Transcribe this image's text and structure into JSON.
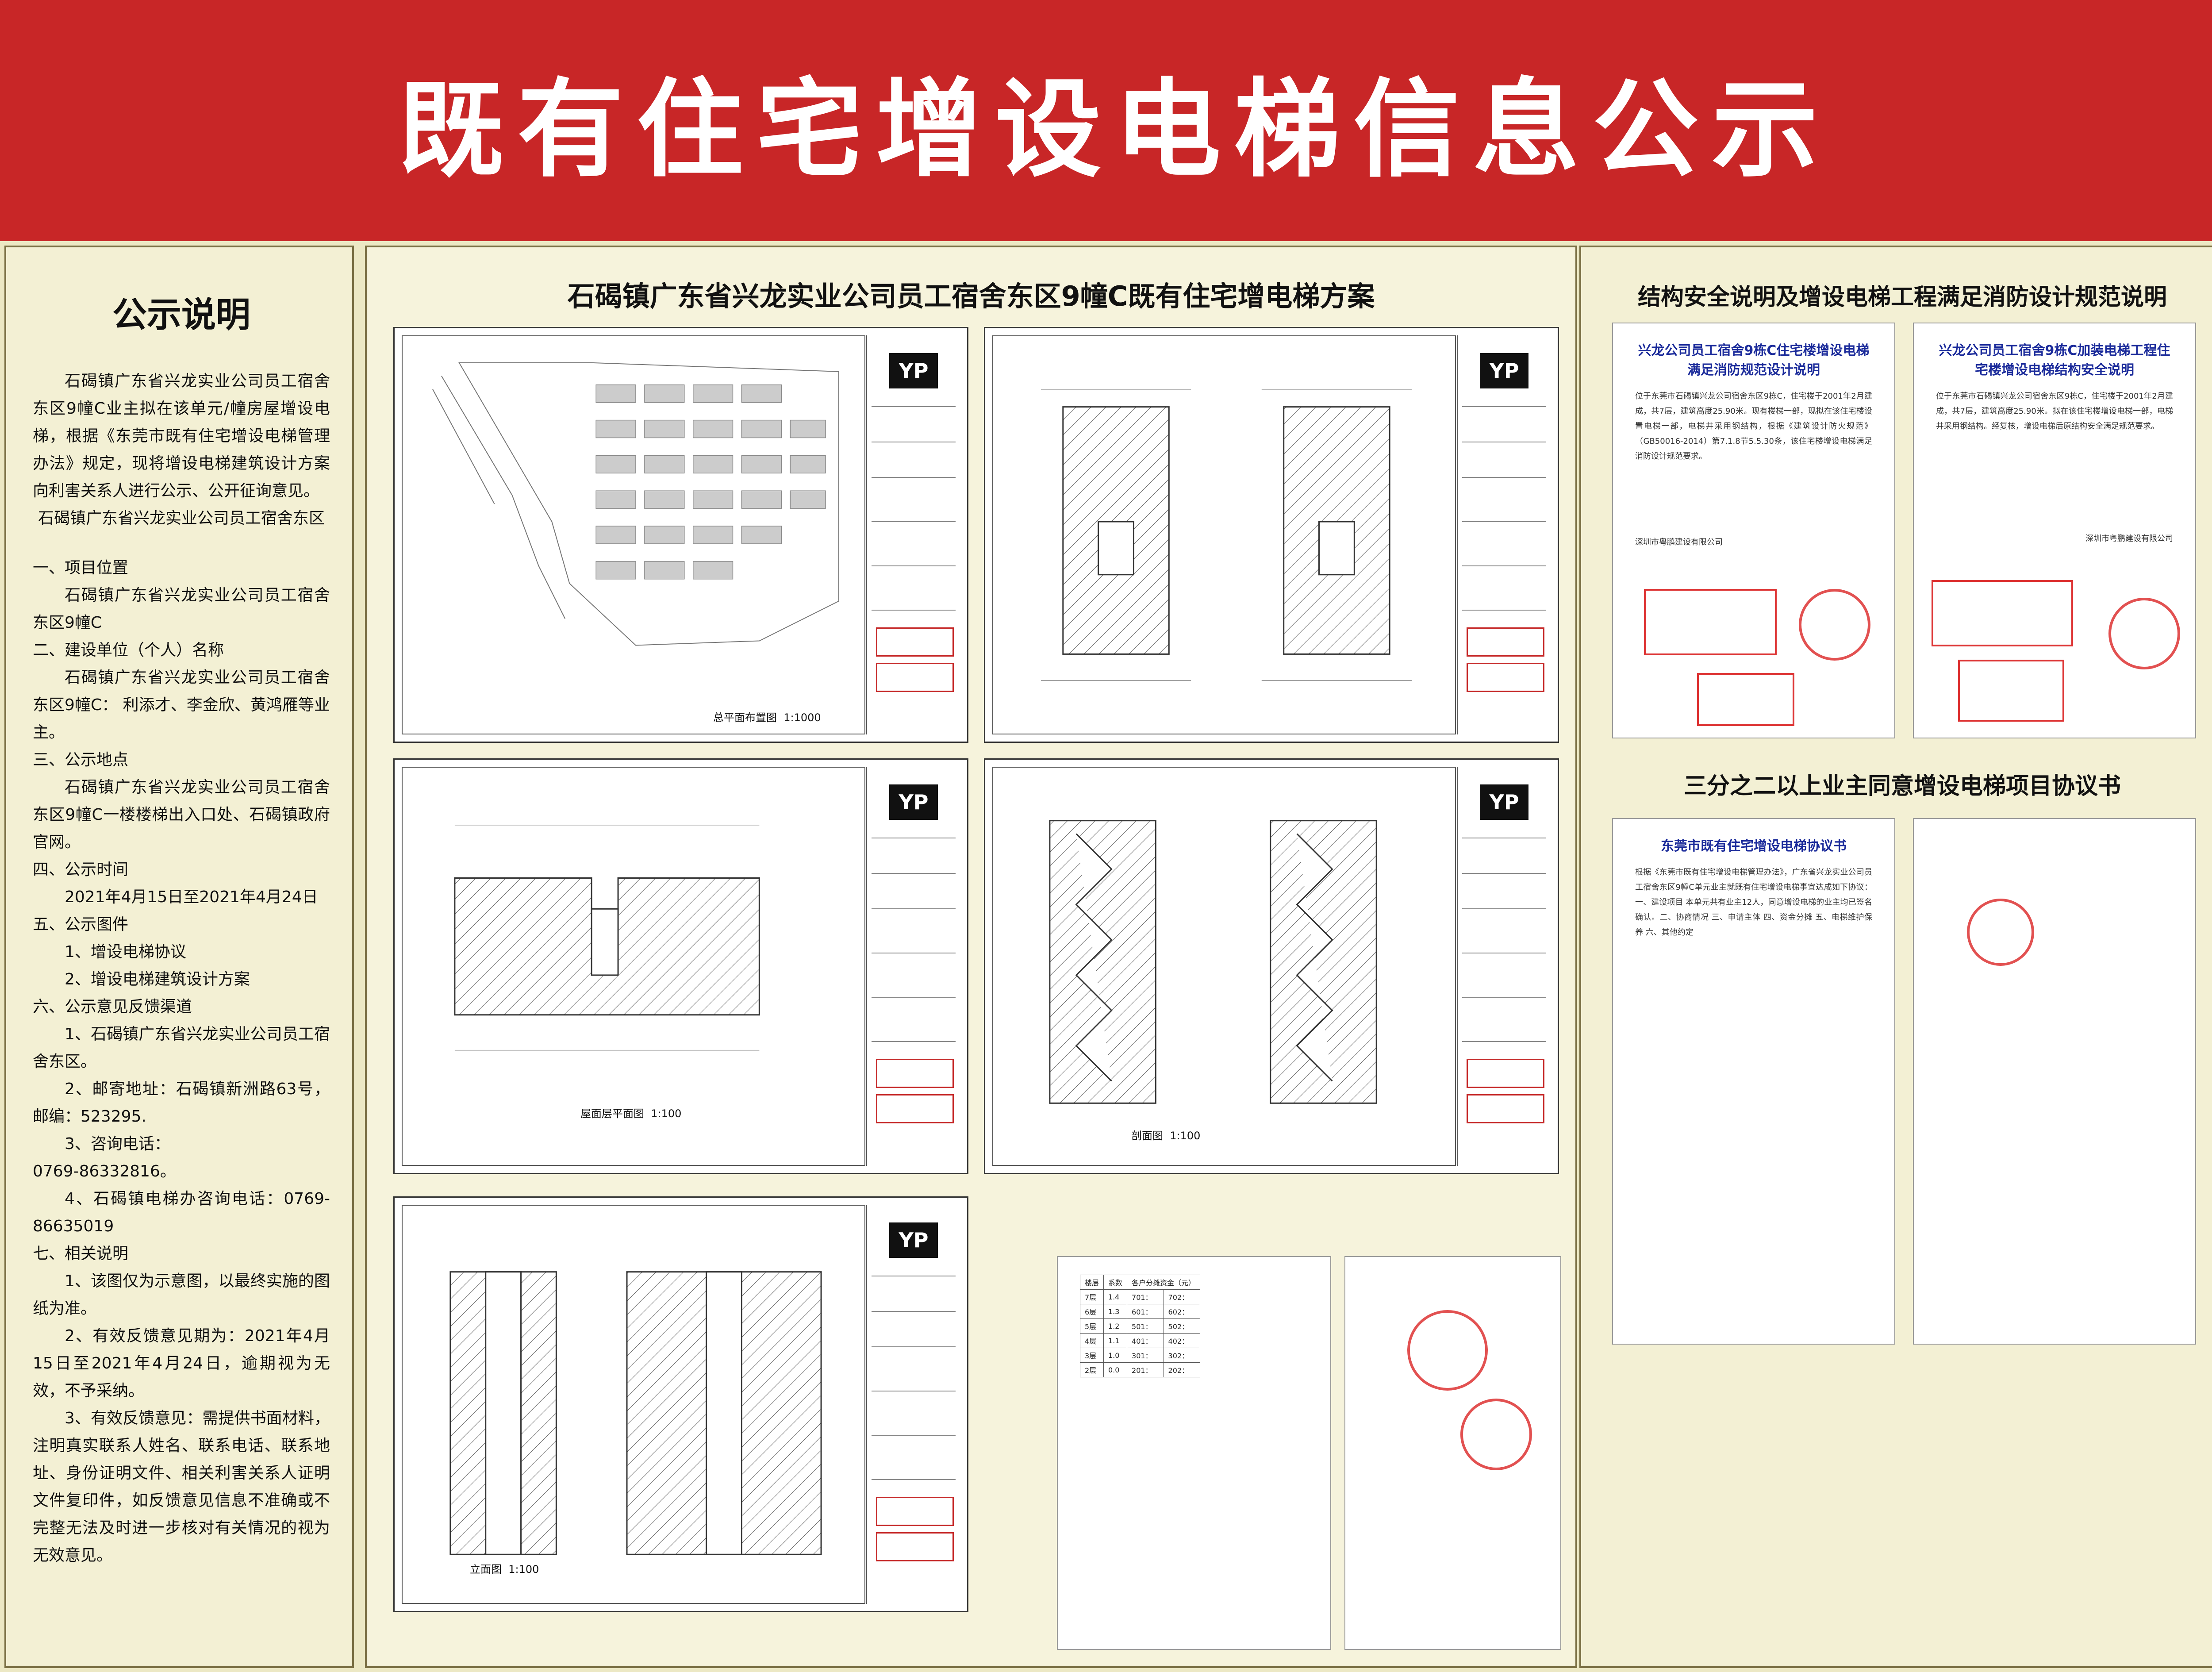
{
  "banner": {
    "title": "既有住宅增设电梯信息公示"
  },
  "notice": {
    "heading": "公示说明",
    "intro": "石碣镇广东省兴龙实业公司员工宿舍东区9幢C业主拟在该单元/幢房屋增设电梯，根据《东莞市既有住宅增设电梯管理办法》规定，现将增设电梯建筑设计方案向利害关系人进行公示、公开征询意见。",
    "signer": "石碣镇广东省兴龙实业公司员工宿舍东区",
    "s1_title": "一、项目位置",
    "s1_text": "石碣镇广东省兴龙实业公司员工宿舍东区9幢C",
    "s2_title": "二、建设单位（个人）名称",
    "s2_text": "石碣镇广东省兴龙实业公司员工宿舍东区9幢C： 利添才、李金欣、黄鸿雁等业主。",
    "s3_title": "三、公示地点",
    "s3_text": "石碣镇广东省兴龙实业公司员工宿舍东区9幢C一楼楼梯出入口处、石碣镇政府官网。",
    "s4_title": "四、公示时间",
    "s4_text": "2021年4月15日至2021年4月24日",
    "s5_title": "五、公示图件",
    "s5_item1": "1、增设电梯协议",
    "s5_item2": "2、增设电梯建筑设计方案",
    "s6_title": "六、公示意见反馈渠道",
    "s6_item1": "1、石碣镇广东省兴龙实业公司员工宿舍东区。",
    "s6_item2": "2、邮寄地址：石碣镇新洲路63号，邮编：523295.",
    "s6_item3": "3、咨询电话：",
    "s6_phone": "0769-86332816。",
    "s6_item4": "4、石碣镇电梯办咨询电话：0769-86635019",
    "s7_title": "七、相关说明",
    "s7_item1": "1、该图仅为示意图，以最终实施的图纸为准。",
    "s7_item2": "2、有效反馈意见期为：2021年4月15日至2021年4月24日，逾期视为无效，不予采纳。",
    "s7_item3": "3、有效反馈意见：需提供书面材料，注明真实联系人姓名、联系电话、联系地址、身份证明文件、相关利害关系人证明文件复印件，如反馈意见信息不准确或不完整无法及时进一步核对有关情况的视为无效意见。"
  },
  "plan": {
    "title": "石碣镇广东省兴龙实业公司员工宿舍东区9幢C既有住宅增电梯方案",
    "logo": "YP",
    "sheet1_caption": "总平面布置图",
    "sheet1_scale": "1:1000",
    "sheet3_caption": "屋面层平面图",
    "sheet3_scale": "1:100",
    "sheet4_caption": "剖面图",
    "sheet4_scale": "1:100",
    "sheet5_caption": "立面图",
    "sheet5_scale": "1:100"
  },
  "right": {
    "sec1_title": "结构安全说明及增设电梯工程满足消防设计规范说明",
    "doc1_title": "兴龙公司员工宿舍9栋C住宅楼增设电梯满足消防规范设计说明",
    "doc1_text": "位于东莞市石碣镇兴龙公司宿舍东区9栋C，住宅楼于2001年2月建成，共7层，建筑高度25.90米。现有楼梯一部，现拟在该住宅楼设置电梯一部，电梯井采用钢结构，根据《建筑设计防火规范》（GB50016-2014）第7.1.8节5.5.30条，该住宅楼增设电梯满足消防设计规范要求。",
    "doc2_title": "兴龙公司员工宿舍9栋C加装电梯工程住宅楼增设电梯结构安全说明",
    "doc2_text": "位于东莞市石碣镇兴龙公司宿舍东区9栋C，住宅楼于2001年2月建成，共7层，建筑高度25.90米。拟在该住宅楼增设电梯一部，电梯井采用钢结构。经复核，增设电梯后原结构安全满足规范要求。",
    "sign": "深圳市粤鹏建设有限公司",
    "sec2_title": "三分之二以上业主同意增设电梯项目协议书",
    "agree_title": "东莞市既有住宅增设电梯协议书",
    "agree_text": "根据《东莞市既有住宅增设电梯管理办法》，广东省兴龙实业公司员工宿舍东区9幢C单元业主就既有住宅增设电梯事宜达成如下协议：一、建设项目 本单元共有业主12人，同意增设电梯的业主均已签名确认。二、协商情况 三、申请主体 四、资金分摊 五、电梯维护保养 六、其他约定"
  },
  "fee_table": {
    "header": [
      "楼层",
      "系数",
      "各户分摊资金（元）"
    ],
    "rows": [
      [
        "7层",
        "1.4",
        "701：",
        "702："
      ],
      [
        "6层",
        "1.3",
        "601：",
        "602："
      ],
      [
        "5层",
        "1.2",
        "501：",
        "502："
      ],
      [
        "4层",
        "1.1",
        "401：",
        "402："
      ],
      [
        "3层",
        "1.0",
        "301：",
        "302："
      ],
      [
        "2层",
        "0.0",
        "201：",
        "202："
      ]
    ]
  }
}
